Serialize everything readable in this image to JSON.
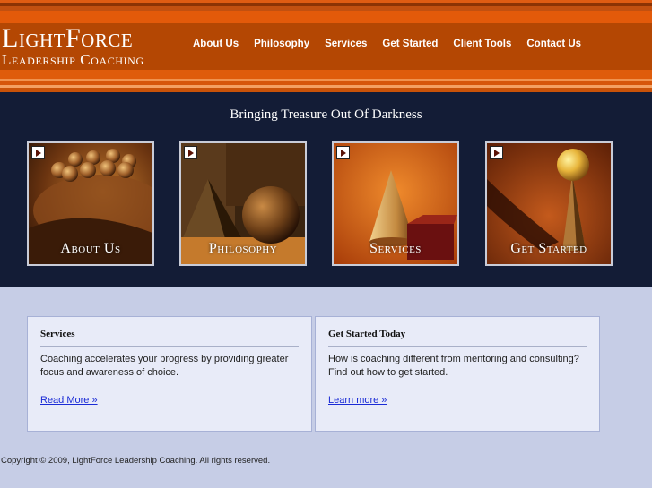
{
  "brand": {
    "line1": "LightForce",
    "line2": "Leadership Coaching"
  },
  "nav": [
    {
      "label": "About Us"
    },
    {
      "label": "Philosophy"
    },
    {
      "label": "Services"
    },
    {
      "label": "Get Started"
    },
    {
      "label": "Client Tools"
    },
    {
      "label": "Contact Us"
    }
  ],
  "banner": {
    "tagline": "Bringing Treasure Out Of Darkness",
    "tiles": [
      {
        "label": "About Us",
        "icon": "play-icon"
      },
      {
        "label": "Philosophy",
        "icon": "play-icon"
      },
      {
        "label": "Services",
        "icon": "play-icon"
      },
      {
        "label": "Get Started",
        "icon": "play-icon"
      }
    ]
  },
  "panels": [
    {
      "heading": "Services",
      "text": "Coaching accelerates your progress by providing greater focus and awareness of choice.",
      "link": "Read More »"
    },
    {
      "heading": "Get Started Today",
      "text": "How is coaching different from mentoring and consulting? Find out how to get started.",
      "link": "Learn more »"
    }
  ],
  "footer": {
    "copyright": "Copyright © 2009, LightForce Leadership Coaching. All rights reserved."
  },
  "colors": {
    "header_orange": "#b84a06",
    "banner_navy": "#131c36",
    "page_background": "#c6cde6",
    "link_blue": "#1a2bd6"
  }
}
